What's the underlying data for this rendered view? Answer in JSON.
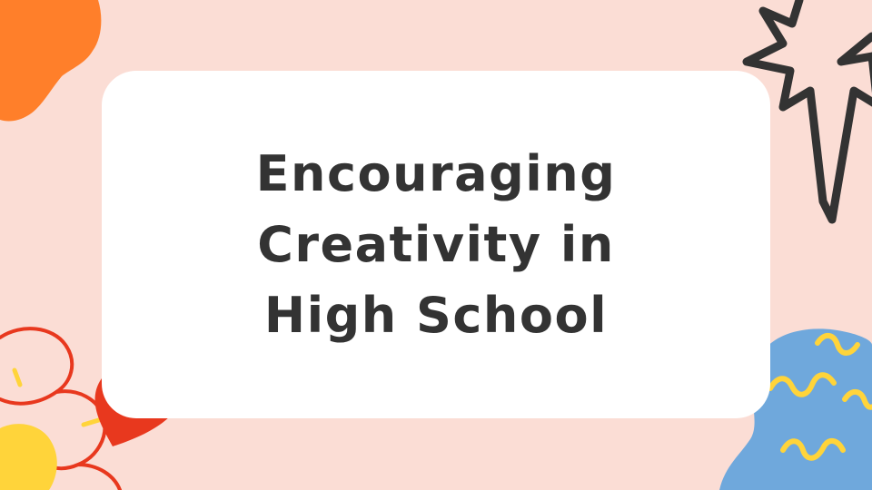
{
  "slide": {
    "title": "Encouraging Creativity in High School"
  },
  "colors": {
    "background": "#FBDDD5",
    "card": "#FFFFFF",
    "text": "#333333",
    "orange_blob": "#FF7F2A",
    "red_heart": "#E8381E",
    "red_outline": "#E8381E",
    "yellow": "#FFD43A",
    "blue_blob": "#6FA8DC",
    "star_outline": "#333333"
  },
  "decorations": [
    "orange-blob",
    "star-outline",
    "flower-outline",
    "heart",
    "yellow-blob",
    "blue-squiggle-blob"
  ]
}
